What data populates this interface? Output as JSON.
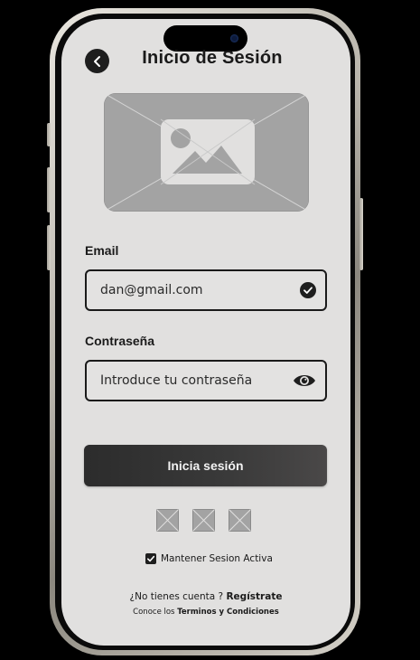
{
  "header": {
    "title": "Inicio de Sesión",
    "back_icon": "chevron-left-icon"
  },
  "hero": {
    "icon": "image-placeholder-icon"
  },
  "email": {
    "label": "Email",
    "value": "dan@gmail.com",
    "status_icon": "check-circle-icon"
  },
  "password": {
    "label": "Contraseña",
    "placeholder": "Introduce tu contraseña",
    "toggle_icon": "eye-icon"
  },
  "login_button": {
    "label": "Inicia sesión"
  },
  "social": {
    "slots": [
      "placeholder-icon",
      "placeholder-icon",
      "placeholder-icon"
    ]
  },
  "remember": {
    "label": "Mantener Sesion Activa",
    "checked": true
  },
  "signup": {
    "prompt": "¿No tienes cuenta ? ",
    "link": "Regístrate"
  },
  "terms": {
    "prompt": "Conoce los ",
    "link": "Terminos y Condiciones"
  },
  "colors": {
    "screen_bg": "#e1e0df",
    "ink": "#1a1a1a",
    "button_dark": "#2c2c2c",
    "placeholder_gray": "#a3a3a3"
  }
}
